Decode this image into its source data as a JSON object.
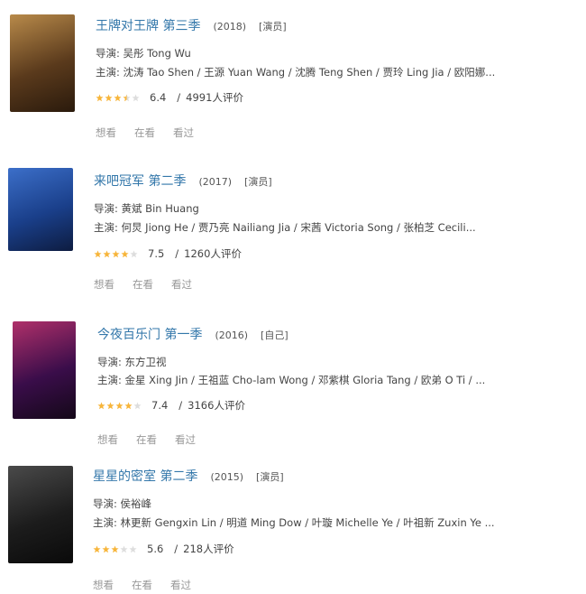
{
  "items": [
    {
      "title": "王牌对王牌 第三季",
      "year": "(2018)",
      "role": "[演员]",
      "director_label": "导演:",
      "director": "吴彤 Tong Wu",
      "cast_label": "主演:",
      "cast": "沈涛 Tao Shen / 王源 Yuan Wang / 沈腾 Teng Shen / 贾玲 Ling Jia / 欧阳娜...",
      "stars": 3.5,
      "score": "6.4",
      "separator": "/",
      "reviews": "4991人评价",
      "actions": [
        "想看",
        "在看",
        "看过"
      ],
      "poster_colors": [
        "#5a3a1c",
        "#b88a4a",
        "#2a1a0c"
      ],
      "poster_text": ""
    },
    {
      "title": "来吧冠军 第二季",
      "year": "(2017)",
      "role": "[演员]",
      "director_label": "导演:",
      "director": "黄斌 Bin Huang",
      "cast_label": "主演:",
      "cast": "何炅 Jiong He / 贾乃亮 Nailiang Jia / 宋茜 Victoria Song / 张柏芝 Cecili...",
      "stars": 4,
      "score": "7.5",
      "separator": "/",
      "reviews": "1260人评价",
      "actions": [
        "想看",
        "在看",
        "看过"
      ],
      "poster_colors": [
        "#1a3f8a",
        "#3c6fc9",
        "#0d1c40"
      ],
      "poster_text": ""
    },
    {
      "title": "今夜百乐门 第一季",
      "year": "(2016)",
      "role": "[自己]",
      "director_label": "导演:",
      "director": "东方卫视",
      "cast_label": "主演:",
      "cast": "金星 Xing Jin / 王祖蓝 Cho-lam Wong / 邓紫棋 Gloria Tang / 欧弟 O Ti / ...",
      "stars": 4,
      "score": "7.4",
      "separator": "/",
      "reviews": "3166人评价",
      "actions": [
        "想看",
        "在看",
        "看过"
      ],
      "poster_colors": [
        "#3a0d4a",
        "#b0306a",
        "#140818"
      ],
      "poster_text": ""
    },
    {
      "title": "星星的密室 第二季",
      "year": "(2015)",
      "role": "[演员]",
      "director_label": "导演:",
      "director": "侯裕峰",
      "cast_label": "主演:",
      "cast": "林更新 Gengxin Lin / 明道 Ming Dow / 叶璇 Michelle Ye / 叶祖新 Zuxin Ye ...",
      "stars": 3,
      "score": "5.6",
      "separator": "/",
      "reviews": "218人评价",
      "actions": [
        "想看",
        "在看",
        "看过"
      ],
      "poster_colors": [
        "#1c1c1c",
        "#4a4a4a",
        "#0a0a0a"
      ],
      "poster_text": ""
    }
  ],
  "star_color": "#f7b53a",
  "star_empty_color": "#dddddd"
}
